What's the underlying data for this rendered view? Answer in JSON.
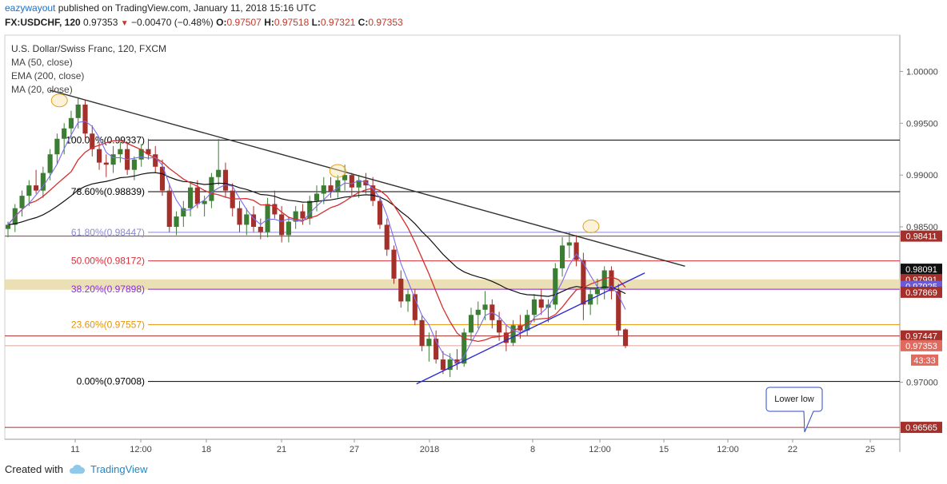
{
  "header": {
    "user": "eazywayout",
    "published": "published on TradingView.com, January 11, 2018 15:16 UTC",
    "symbol": "FX:USDCHF, 120",
    "last": "0.97353",
    "change": "−0.00470 (−0.48%)",
    "o_label": "O:",
    "o": "0.97507",
    "h_label": "H:",
    "h": "0.97518",
    "l_label": "L:",
    "l": "0.97321",
    "c_label": "C:",
    "c": "0.97353"
  },
  "legend": {
    "title": "U.S. Dollar/Swiss Franc, 120, FXCM",
    "ma50": "MA (50, close)",
    "ema200": "EMA (200, close)",
    "ma20": "MA (20, close)"
  },
  "footer": {
    "created_with": "Created with",
    "brand": "TradingView"
  },
  "colors": {
    "candle_up": "#3a7d33",
    "candle_down": "#a4302b",
    "ma50": "#d32f2f",
    "ema200": "#111111",
    "ma20": "#7b6cf0",
    "trend": "#2b2bd6",
    "resistance": "#333333",
    "zone": "#e8d9a8"
  },
  "chart_data": {
    "type": "candlestick",
    "title": "U.S. Dollar/Swiss Franc, 120, FXCM",
    "ylim": [
      0.9645,
      1.0035
    ],
    "y_ticks": [
      "1.00000",
      "0.99500",
      "0.99000",
      "0.98500",
      "0.97000"
    ],
    "x_ticks": [
      "11",
      "12:00",
      "18",
      "21",
      "27",
      "2018",
      "8",
      "12:00",
      "15",
      "12:00",
      "22",
      "25"
    ],
    "price_labels": [
      {
        "value": 0.98411,
        "text": "0.98411",
        "bg": "#a4302b"
      },
      {
        "value": 0.98091,
        "text": "0.98091",
        "bg": "#111111"
      },
      {
        "value": 0.97991,
        "text": "0.97991",
        "bg": "#a4302b"
      },
      {
        "value": 0.97925,
        "text": "0.97925",
        "bg": "#6b5bd6"
      },
      {
        "value": 0.97869,
        "text": "0.97869",
        "bg": "#a4302b"
      },
      {
        "value": 0.97447,
        "text": "0.97447",
        "bg": "#a4302b"
      },
      {
        "value": 0.97353,
        "text": "0.97353",
        "bg": "#e06a5e"
      },
      {
        "value": 0.96565,
        "text": "0.96565",
        "bg": "#a4302b"
      }
    ],
    "countdown": "43:33",
    "fib_levels": [
      {
        "label": "100.00%(0.99337)",
        "value": 0.99337,
        "color": "#000000"
      },
      {
        "label": "78.60%(0.98839)",
        "value": 0.98839,
        "color": "#000000"
      },
      {
        "label": "61.80%(0.98447)",
        "value": 0.98447,
        "color": "#8a8ad0"
      },
      {
        "label": "50.00%(0.98172)",
        "value": 0.98172,
        "color": "#d9303a"
      },
      {
        "label": "38.20%(0.97898)",
        "value": 0.97898,
        "color": "#8a2be2"
      },
      {
        "label": "23.60%(0.97557)",
        "value": 0.97557,
        "color": "#e69500"
      },
      {
        "label": "0.00%(0.97008)",
        "value": 0.97008,
        "color": "#000000"
      }
    ],
    "horizontal_lines": [
      {
        "value": 0.98411,
        "color": "#a4302b"
      },
      {
        "value": 0.97447,
        "color": "#a4302b"
      },
      {
        "value": 0.97353,
        "color": "#e0a09a"
      },
      {
        "value": 0.96565,
        "color": "#a4302b"
      }
    ],
    "zone": {
      "from": 0.97893,
      "to": 0.97993
    },
    "trendlines": [
      {
        "name": "resistance",
        "x1": 0.05,
        "y1": 0.9982,
        "x2": 0.76,
        "y2": 0.9812
      },
      {
        "name": "support",
        "x1": 0.46,
        "y1": 0.96985,
        "x2": 0.715,
        "y2": 0.98055
      }
    ],
    "callout": {
      "text": "Lower low"
    },
    "candles": [
      [
        0.9848,
        0.9855,
        0.984,
        0.9852
      ],
      [
        0.9852,
        0.9872,
        0.9845,
        0.9868
      ],
      [
        0.9868,
        0.9885,
        0.986,
        0.988
      ],
      [
        0.988,
        0.9895,
        0.987,
        0.989
      ],
      [
        0.989,
        0.9905,
        0.9882,
        0.9885
      ],
      [
        0.9885,
        0.9908,
        0.9878,
        0.9902
      ],
      [
        0.9902,
        0.9925,
        0.9895,
        0.992
      ],
      [
        0.992,
        0.994,
        0.991,
        0.9935
      ],
      [
        0.9935,
        0.995,
        0.992,
        0.9945
      ],
      [
        0.9945,
        0.9962,
        0.9935,
        0.9955
      ],
      [
        0.9955,
        0.9975,
        0.9945,
        0.9968
      ],
      [
        0.9968,
        0.9972,
        0.9935,
        0.994
      ],
      [
        0.994,
        0.9948,
        0.9918,
        0.9925
      ],
      [
        0.9925,
        0.9932,
        0.9905,
        0.9912
      ],
      [
        0.9912,
        0.992,
        0.9898,
        0.991
      ],
      [
        0.991,
        0.9928,
        0.9902,
        0.992
      ],
      [
        0.992,
        0.9932,
        0.9912,
        0.9925
      ],
      [
        0.9925,
        0.993,
        0.99,
        0.9905
      ],
      [
        0.9905,
        0.9918,
        0.9895,
        0.9915
      ],
      [
        0.9915,
        0.993,
        0.9908,
        0.9925
      ],
      [
        0.9925,
        0.9935,
        0.9915,
        0.992
      ],
      [
        0.992,
        0.9928,
        0.9902,
        0.9908
      ],
      [
        0.9908,
        0.9915,
        0.988,
        0.9885
      ],
      [
        0.9885,
        0.9892,
        0.9845,
        0.985
      ],
      [
        0.985,
        0.9865,
        0.9842,
        0.986
      ],
      [
        0.986,
        0.9875,
        0.985,
        0.9868
      ],
      [
        0.9868,
        0.9892,
        0.986,
        0.9888
      ],
      [
        0.9888,
        0.9895,
        0.9868,
        0.9872
      ],
      [
        0.9872,
        0.988,
        0.986,
        0.9875
      ],
      [
        0.9875,
        0.9902,
        0.9868,
        0.9898
      ],
      [
        0.9898,
        0.9935,
        0.989,
        0.9905
      ],
      [
        0.9905,
        0.9912,
        0.9878,
        0.9885
      ],
      [
        0.9885,
        0.9892,
        0.986,
        0.9868
      ],
      [
        0.9868,
        0.9875,
        0.9845,
        0.9852
      ],
      [
        0.9852,
        0.9868,
        0.9842,
        0.9862
      ],
      [
        0.9862,
        0.987,
        0.9845,
        0.985
      ],
      [
        0.985,
        0.9858,
        0.9838,
        0.9845
      ],
      [
        0.9845,
        0.9878,
        0.984,
        0.9872
      ],
      [
        0.9872,
        0.9885,
        0.9858,
        0.9862
      ],
      [
        0.9862,
        0.987,
        0.9835,
        0.9842
      ],
      [
        0.9842,
        0.986,
        0.9835,
        0.9855
      ],
      [
        0.9855,
        0.987,
        0.9848,
        0.9865
      ],
      [
        0.9865,
        0.9872,
        0.9852,
        0.9858
      ],
      [
        0.9858,
        0.988,
        0.9852,
        0.9875
      ],
      [
        0.9875,
        0.989,
        0.9865,
        0.9882
      ],
      [
        0.9882,
        0.9898,
        0.9872,
        0.989
      ],
      [
        0.989,
        0.9898,
        0.9878,
        0.9884
      ],
      [
        0.9884,
        0.99,
        0.9878,
        0.9895
      ],
      [
        0.9895,
        0.991,
        0.9885,
        0.99
      ],
      [
        0.99,
        0.9902,
        0.988,
        0.9888
      ],
      [
        0.9888,
        0.99,
        0.9878,
        0.9895
      ],
      [
        0.9895,
        0.9902,
        0.9882,
        0.989
      ],
      [
        0.989,
        0.9898,
        0.987,
        0.9875
      ],
      [
        0.9875,
        0.988,
        0.9848,
        0.9852
      ],
      [
        0.9852,
        0.9858,
        0.9822,
        0.9828
      ],
      [
        0.9828,
        0.9832,
        0.9795,
        0.98
      ],
      [
        0.98,
        0.9808,
        0.9772,
        0.9778
      ],
      [
        0.9778,
        0.979,
        0.9768,
        0.9785
      ],
      [
        0.9785,
        0.979,
        0.9755,
        0.976
      ],
      [
        0.976,
        0.9765,
        0.973,
        0.9735
      ],
      [
        0.9735,
        0.9748,
        0.972,
        0.9742
      ],
      [
        0.9742,
        0.975,
        0.9718,
        0.9722
      ],
      [
        0.9722,
        0.973,
        0.9708,
        0.9712
      ],
      [
        0.9712,
        0.9728,
        0.9705,
        0.9722
      ],
      [
        0.9722,
        0.9732,
        0.9712,
        0.9718
      ],
      [
        0.9718,
        0.9752,
        0.9715,
        0.9748
      ],
      [
        0.9748,
        0.9772,
        0.974,
        0.9765
      ],
      [
        0.9765,
        0.9778,
        0.9752,
        0.977
      ],
      [
        0.977,
        0.9788,
        0.976,
        0.9775
      ],
      [
        0.9775,
        0.978,
        0.9752,
        0.976
      ],
      [
        0.976,
        0.9768,
        0.974,
        0.9748
      ],
      [
        0.9748,
        0.9755,
        0.973,
        0.9738
      ],
      [
        0.9738,
        0.976,
        0.9735,
        0.9755
      ],
      [
        0.9755,
        0.9765,
        0.9742,
        0.975
      ],
      [
        0.975,
        0.977,
        0.9745,
        0.9765
      ],
      [
        0.9765,
        0.9785,
        0.9758,
        0.978
      ],
      [
        0.978,
        0.979,
        0.9765,
        0.9772
      ],
      [
        0.9772,
        0.978,
        0.9758,
        0.9775
      ],
      [
        0.9775,
        0.9815,
        0.977,
        0.981
      ],
      [
        0.981,
        0.984,
        0.9802,
        0.9832
      ],
      [
        0.9832,
        0.9845,
        0.982,
        0.9835
      ],
      [
        0.9835,
        0.9842,
        0.9812,
        0.9818
      ],
      [
        0.9818,
        0.9825,
        0.976,
        0.9775
      ],
      [
        0.9775,
        0.979,
        0.9765,
        0.9785
      ],
      [
        0.9785,
        0.98,
        0.9775,
        0.979
      ],
      [
        0.979,
        0.9812,
        0.978,
        0.9808
      ],
      [
        0.9808,
        0.9812,
        0.978,
        0.9788
      ],
      [
        0.9788,
        0.9795,
        0.9745,
        0.975
      ],
      [
        0.9751,
        0.9752,
        0.9733,
        0.9735
      ]
    ]
  }
}
